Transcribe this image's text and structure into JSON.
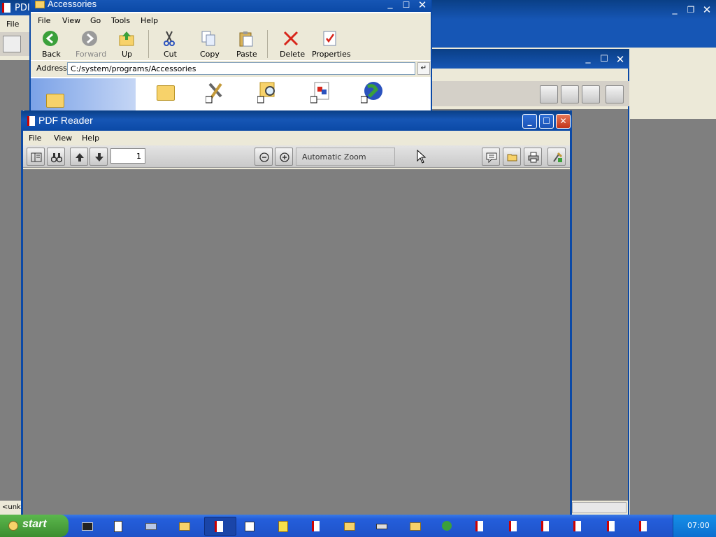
{
  "background_windows": {
    "left_window_title": "PDI",
    "left_menu": "File",
    "left_status_text": "<unk",
    "right_window_controls": [
      "minimize",
      "restore",
      "close"
    ]
  },
  "accessories": {
    "title": "Accessories",
    "menu": [
      "File",
      "View",
      "Go",
      "Tools",
      "Help"
    ],
    "toolbar": {
      "back": "Back",
      "forward": "Forward",
      "up": "Up",
      "cut": "Cut",
      "copy": "Copy",
      "paste": "Paste",
      "delete": "Delete",
      "properties": "Properties"
    },
    "address_label": "Address",
    "address_value": "C:/system/programs/Accessories"
  },
  "pdf_reader": {
    "title": "PDF Reader",
    "menu": [
      "File",
      "View",
      "Help"
    ],
    "page_number": "1",
    "zoom_label": "Automatic Zoom"
  },
  "taskbar": {
    "start_label": "start",
    "clock": "07:00"
  },
  "colors": {
    "desktop": "#5a7fb8",
    "titlebar": "#1656b5",
    "taskbar": "#245edb",
    "start": "#3c8d2f",
    "document_bg": "#7f7f7f"
  }
}
